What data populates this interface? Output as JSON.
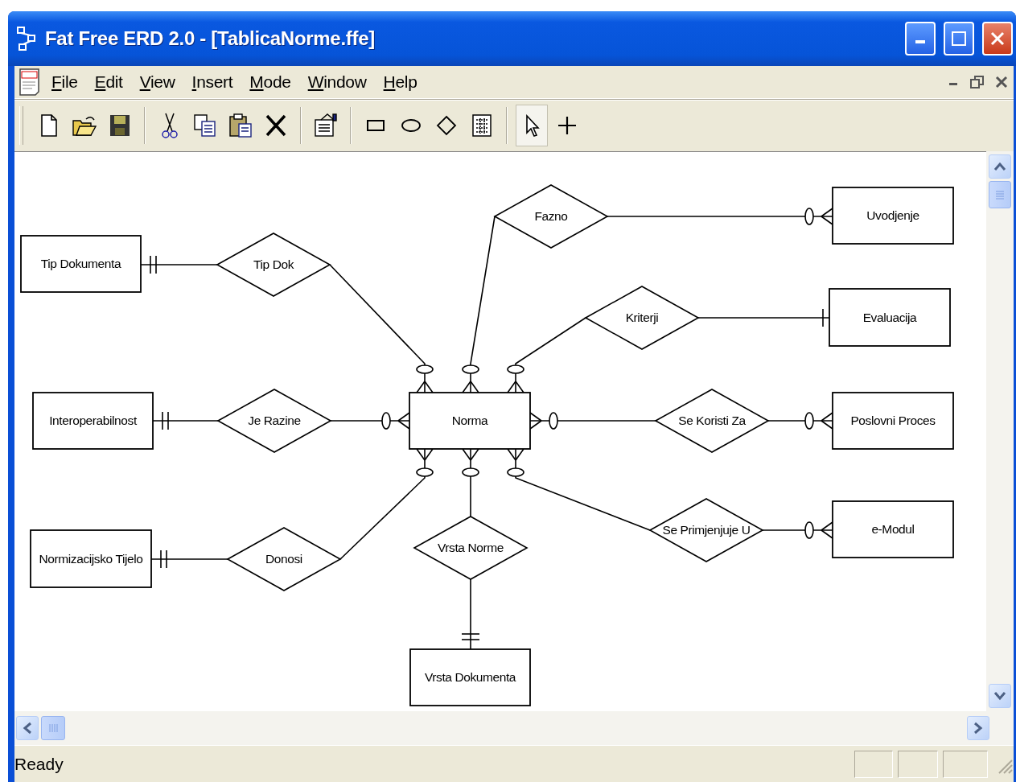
{
  "window": {
    "title": "Fat Free ERD 2.0 - [TablicaNorme.ffe]"
  },
  "menu": [
    "File",
    "Edit",
    "View",
    "Insert",
    "Mode",
    "Window",
    "Help"
  ],
  "mode_tools": [
    {
      "selected": true
    },
    {
      "selected": false
    }
  ],
  "diagram": {
    "entities": [
      {
        "name": "Tip Dokumenta"
      },
      {
        "name": "Uvodjenje"
      },
      {
        "name": "Evaluacija"
      },
      {
        "name": "Interoperabilnost"
      },
      {
        "name": "Norma"
      },
      {
        "name": "Poslovni Proces"
      },
      {
        "name": "Normizacijsko Tijelo"
      },
      {
        "name": "e-Modul"
      },
      {
        "name": "Vrsta Dokumenta"
      }
    ],
    "relationships": [
      {
        "name": "Fazno",
        "ends": [
          {
            "kind": "zero-or-many"
          },
          {
            "kind": "zero-or-many"
          }
        ]
      },
      {
        "name": "Tip Dok",
        "ends": [
          {
            "kind": "one-and-only-one"
          },
          {
            "kind": "zero-or-many"
          }
        ]
      },
      {
        "name": "Kriterji",
        "ends": [
          {
            "kind": "zero-or-many"
          },
          {
            "kind": "one"
          }
        ]
      },
      {
        "name": "Je Razine",
        "ends": [
          {
            "kind": "one-and-only-one"
          },
          {
            "kind": "zero-or-many"
          }
        ]
      },
      {
        "name": "Se Koristi Za",
        "ends": [
          {
            "kind": "zero-or-many"
          },
          {
            "kind": "zero-or-many"
          }
        ]
      },
      {
        "name": "Se Primjenjuje U",
        "ends": [
          {
            "kind": "zero-or-many"
          },
          {
            "kind": "zero-or-many"
          }
        ]
      },
      {
        "name": "Donosi",
        "ends": [
          {
            "kind": "one-and-only-one"
          },
          {
            "kind": "zero-or-many"
          }
        ]
      },
      {
        "name": "Vrsta Norme",
        "ends": [
          {
            "kind": "zero-or-many"
          },
          {
            "kind": "one-and-only-one"
          }
        ]
      }
    ]
  },
  "status_bar": {
    "text": "Ready"
  }
}
